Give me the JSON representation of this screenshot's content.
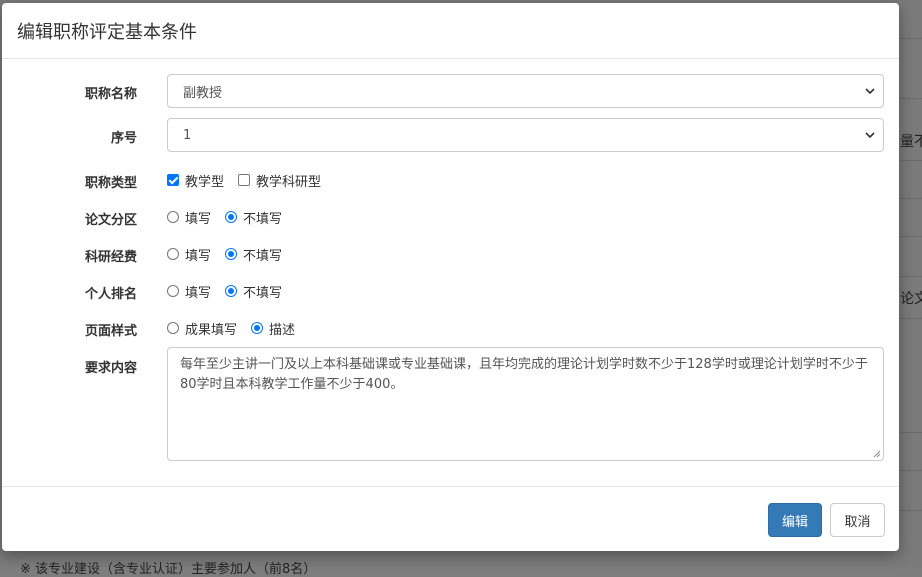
{
  "background": {
    "side_snippets": [
      "量不",
      "论文"
    ],
    "bottom_text": "※ 该专业建设（含专业认证）主要参加人（前8名）"
  },
  "modal": {
    "title": "编辑职称评定基本条件",
    "fields": {
      "title_name": {
        "label": "职称名称",
        "value": "副教授"
      },
      "order": {
        "label": "序号",
        "value": "1"
      },
      "title_type": {
        "label": "职称类型",
        "options": [
          {
            "label": "教学型",
            "checked": true
          },
          {
            "label": "教学科研型",
            "checked": false
          }
        ]
      },
      "paper_zone": {
        "label": "论文分区",
        "options": [
          {
            "label": "填写",
            "checked": false
          },
          {
            "label": "不填写",
            "checked": true
          }
        ]
      },
      "research_funding": {
        "label": "科研经费",
        "options": [
          {
            "label": "填写",
            "checked": false
          },
          {
            "label": "不填写",
            "checked": true
          }
        ]
      },
      "personal_rank": {
        "label": "个人排名",
        "options": [
          {
            "label": "填写",
            "checked": false
          },
          {
            "label": "不填写",
            "checked": true
          }
        ]
      },
      "page_style": {
        "label": "页面样式",
        "options": [
          {
            "label": "成果填写",
            "checked": false
          },
          {
            "label": "描述",
            "checked": true
          }
        ]
      },
      "requirements": {
        "label": "要求内容",
        "value": "每年至少主讲一门及以上本科基础课或专业基础课，且年均完成的理论计划学时数不少于128学时或理论计划学时不少于80学时且本科教学工作量不少于400。"
      }
    },
    "footer": {
      "edit_label": "编辑",
      "cancel_label": "取消"
    }
  },
  "colors": {
    "primary": "#337ab7",
    "check_blue": "#0075ff",
    "overlay": "#7d7d7d"
  },
  "icons": {
    "select_caret": "chevron-down-icon",
    "textarea_grip": "resize-handle-icon"
  }
}
